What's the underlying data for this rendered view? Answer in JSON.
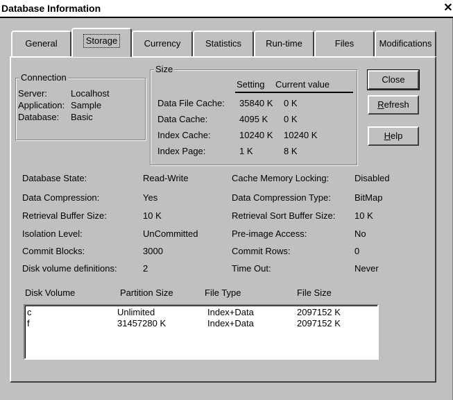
{
  "window": {
    "title": "Database Information",
    "close_glyph": "✕"
  },
  "tabs": [
    "General",
    "Storage",
    "Currency",
    "Statistics",
    "Run-time",
    "Files",
    "Modifications"
  ],
  "active_tab": "Storage",
  "connection": {
    "legend": "Connection",
    "rows": [
      {
        "label": "Server:",
        "value": "Localhost"
      },
      {
        "label": "Application:",
        "value": "Sample"
      },
      {
        "label": "Database:",
        "value": "Basic"
      }
    ]
  },
  "size": {
    "legend": "Size",
    "col_setting": "Setting",
    "col_current": "Current value",
    "rows": [
      {
        "label": "Data File Cache:",
        "setting": "35840 K",
        "current": "0 K"
      },
      {
        "label": "Data Cache:",
        "setting": "4095 K",
        "current": "0 K"
      },
      {
        "label": "Index Cache:",
        "setting": "10240 K",
        "current": "10240 K"
      },
      {
        "label": "Index Page:",
        "setting": "1 K",
        "current": "8 K"
      }
    ]
  },
  "buttons": {
    "close": "Close",
    "refresh_u": "R",
    "refresh_rest": "efresh",
    "help_u": "H",
    "help_rest": "elp"
  },
  "props_left": [
    {
      "label": "Database State:",
      "value": "Read-Write"
    },
    {
      "label": "Data Compression:",
      "value": "Yes"
    },
    {
      "label": "Retrieval Buffer Size:",
      "value": "10 K"
    },
    {
      "label": "Isolation Level:",
      "value": "UnCommitted"
    },
    {
      "label": "Commit Blocks:",
      "value": "3000"
    },
    {
      "label": "Disk volume definitions:",
      "value": "2"
    }
  ],
  "props_right": [
    {
      "label": "Cache Memory Locking:",
      "value": "Disabled"
    },
    {
      "label": "Data Compression Type:",
      "value": "BitMap"
    },
    {
      "label": "Retrieval Sort Buffer Size:",
      "value": "10 K"
    },
    {
      "label": "Pre-image Access:",
      "value": "No"
    },
    {
      "label": "Commit Rows:",
      "value": "0"
    },
    {
      "label": "Time Out:",
      "value": "Never"
    }
  ],
  "volumes": {
    "headers": [
      "Disk Volume",
      "Partition Size",
      "File Type",
      "File Size"
    ],
    "rows": [
      [
        "c",
        "Unlimited",
        "Index+Data",
        "2097152 K"
      ],
      [
        "f",
        "31457280 K",
        "Index+Data",
        "2097152 K"
      ]
    ]
  }
}
